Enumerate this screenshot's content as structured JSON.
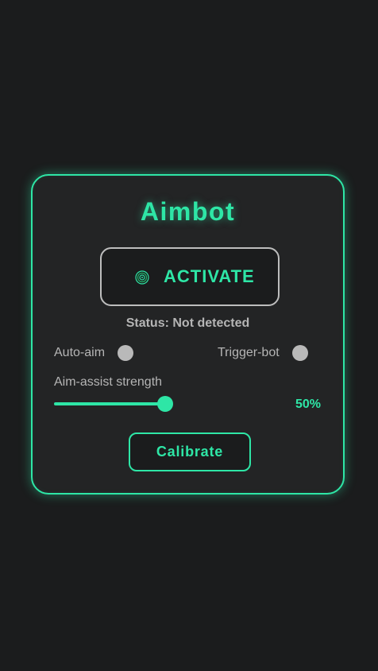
{
  "app": {
    "title": "Aimbot",
    "accent_color": "#2ee6a6"
  },
  "activate_button": {
    "label": "ACTIVATE",
    "icon": "fingerprint-icon"
  },
  "status": {
    "text": "Status: Not detected"
  },
  "toggles": [
    {
      "label": "Auto-aim",
      "state": "off"
    },
    {
      "label": "Trigger-bot",
      "state": "off"
    }
  ],
  "aim_assist": {
    "label": "Aim-assist strength",
    "value_percent": 50,
    "value_text": "50%"
  },
  "calibrate_button": {
    "label": "Calibrate"
  }
}
